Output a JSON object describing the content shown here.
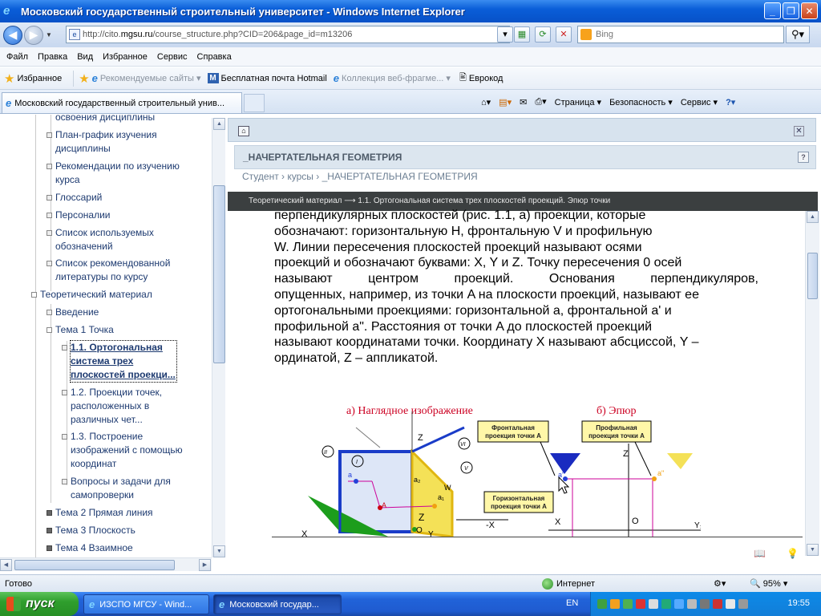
{
  "window": {
    "title": "Московский государственный строительный университет - Windows Internet Explorer"
  },
  "address": {
    "url_prefix": "http://cito.",
    "url_host": "mgsu.ru",
    "url_path": "/course_structure.php?CID=206&page_id=m13206",
    "search_placeholder": "Bing"
  },
  "menu": [
    "Файл",
    "Правка",
    "Вид",
    "Избранное",
    "Сервис",
    "Справка"
  ],
  "favorites": {
    "label": "Избранное",
    "items": [
      {
        "label": "Рекомендуемые сайты ▾"
      },
      {
        "label": "Бесплатная почта Hotmail"
      },
      {
        "label": "Коллекция веб-фрагме... ▾"
      },
      {
        "label": "Еврокод"
      }
    ]
  },
  "tab": {
    "label": "Московский государственный строительный унив..."
  },
  "commandbar": {
    "page": "Страница ▾",
    "safety": "Безопасность ▾",
    "tools": "Сервис ▾"
  },
  "sidebar": {
    "items": [
      {
        "label": "освоения дисциплины"
      },
      {
        "label": "План-график изучения"
      },
      {
        "label": "дисциплины"
      },
      {
        "label": "Рекомендации по изучению"
      },
      {
        "label": "курса"
      },
      {
        "label": "Глоссарий"
      },
      {
        "label": "Персоналии"
      },
      {
        "label": "Список используемых"
      },
      {
        "label": "обозначений"
      },
      {
        "label": "Список рекомендованной"
      },
      {
        "label": "литературы по курсу"
      },
      {
        "label": "Теоретический материал"
      },
      {
        "label": "Введение"
      },
      {
        "label": "Тема 1 Точка"
      },
      {
        "label": "1.1. Ортогональная"
      },
      {
        "label": "система трех"
      },
      {
        "label": "плоскостей проекци..."
      },
      {
        "label": "1.2. Проекции точек,"
      },
      {
        "label": "расположенных в"
      },
      {
        "label": "различных чет..."
      },
      {
        "label": "1.3. Построение"
      },
      {
        "label": "изображений с помощью"
      },
      {
        "label": "координат"
      },
      {
        "label": "Вопросы и задачи для"
      },
      {
        "label": "самопроверки"
      },
      {
        "label": "Тема 2 Прямая линия"
      },
      {
        "label": "Тема 3 Плоскость"
      },
      {
        "label": "Тема 4 Взаимное"
      }
    ]
  },
  "course": {
    "title": "_НАЧЕРТАТЕЛЬНАЯ ГЕОМЕТРИЯ",
    "breadcrumb": "Студент › курсы › _НАЧЕРТАТЕЛЬНАЯ ГЕОМЕТРИЯ",
    "section_bar": "Теоретический материал ⟶ 1.1. Ортогональная система трех плоскостей проекций. Эпюр точки"
  },
  "article": {
    "lines": [
      "перпендикулярных плоскостей (рис. 1.1, а) проекции, которые",
      "обозначают: горизонтальную H, фронтальную V и профильную",
      "W. Линии пересечения плоскостей проекций называют осями",
      "проекций и обозначают буквами: X, Y и Z. Точку пересечения 0 осей",
      "называют центром проекций. Основания перпендикуляров,",
      "опущенных, например, из точки A на плоскости проекций, называют ее",
      "ортогональными проекциями: горизонтальной a, фронтальной a' и",
      "профильной a\". Расстояния от точки A до плоскостей проекций",
      "называют координатами точки. Координату X называют абсциссой, Y –",
      "ординатой, Z – аппликатой."
    ]
  },
  "figure": {
    "caption_a": "а) Наглядное изображение",
    "caption_b": "б) Эпюр",
    "callout_front_1": "Фронтальная",
    "callout_front_2": "проекция точки A",
    "callout_prof_1": "Профильная",
    "callout_prof_2": "проекция точки A",
    "callout_horiz_1": "Горизонтальная",
    "callout_horiz_2": "проекция точки A",
    "labels": {
      "z1": "Z",
      "z2": "Z",
      "zc": "Z",
      "x1": "X",
      "x2": "X",
      "mx": "-X",
      "o1": "O",
      "o2": "O",
      "y1": "Y",
      "y2": "Y₁",
      "A": "A",
      "a": "a",
      "a2": "a₂",
      "ap": "a'",
      "app": "a\"",
      "W": "W",
      "II": "II",
      "I": "I",
      "VI": "VI",
      "V": "V",
      "a1": "a₁"
    }
  },
  "status": {
    "ready": "Готово",
    "zone": "Интернет",
    "zoom": "95%"
  },
  "taskbar": {
    "start": "пуск",
    "tasks": [
      {
        "label": "ИЗСПО МГСУ - Wind..."
      },
      {
        "label": "Московский государ..."
      }
    ],
    "lang": "EN",
    "time": "19:55"
  }
}
